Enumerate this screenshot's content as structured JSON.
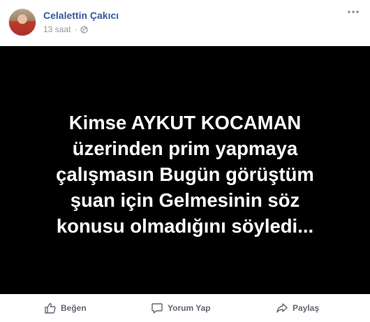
{
  "post": {
    "author": "Celalettin Çakıcı",
    "time": "13 saat",
    "separator": "·",
    "privacy_icon": "globe-icon",
    "menu_icon": "more-dots-icon",
    "image_text_lines": [
      "Kimse AYKUT KOCAMAN",
      "üzerinden prim yapmaya",
      "çalışmasın Bugün görüştüm",
      "şuan için Gelmesinin söz",
      "konusu olmadığını söyledi..."
    ],
    "image_background": "#000000",
    "image_text_color": "#ffffff"
  },
  "actions": {
    "like_label": "Beğen",
    "comment_label": "Yorum Yap",
    "share_label": "Paylaş"
  },
  "colors": {
    "author_link": "#365899",
    "meta_text": "#90949c",
    "action_text": "#616770"
  }
}
